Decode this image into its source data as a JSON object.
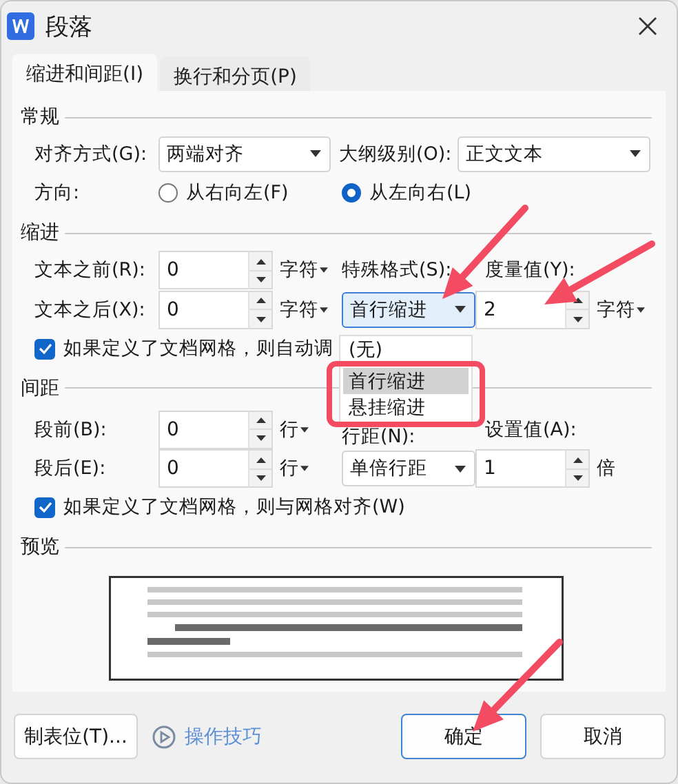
{
  "window": {
    "title": "段落"
  },
  "tabs": [
    {
      "label": "缩进和间距(I)",
      "selected": true
    },
    {
      "label": "换行和分页(P)",
      "selected": false
    }
  ],
  "general": {
    "title": "常规",
    "alignment": {
      "label": "对齐方式(G):",
      "value": "两端对齐"
    },
    "outline_level": {
      "label": "大纲级别(O):",
      "value": "正文文本"
    },
    "direction": {
      "label": "方向:",
      "options": [
        {
          "label": "从右向左(F)",
          "selected": false
        },
        {
          "label": "从左向右(L)",
          "selected": true
        }
      ]
    }
  },
  "indent": {
    "title": "缩进",
    "before": {
      "label": "文本之前(R):",
      "value": "0",
      "unit": "字符"
    },
    "after": {
      "label": "文本之后(X):",
      "value": "0",
      "unit": "字符"
    },
    "special": {
      "label": "特殊格式(S):",
      "value": "首行缩进"
    },
    "measure": {
      "label": "度量值(Y):",
      "value": "2",
      "unit": "字符"
    },
    "grid_check": {
      "label": "如果定义了文档网格，则自动调",
      "checked": true
    }
  },
  "special_menu": [
    {
      "label": "(无)",
      "selected": false
    },
    {
      "label": "首行缩进",
      "selected": true
    },
    {
      "label": "悬挂缩进",
      "selected": false
    }
  ],
  "spacing": {
    "title": "间距",
    "before": {
      "label": "段前(B):",
      "value": "0",
      "unit": "行"
    },
    "after": {
      "label": "段后(E):",
      "value": "0",
      "unit": "行"
    },
    "line": {
      "label": "行距(N):",
      "value": "单倍行距"
    },
    "set_value": {
      "label": "设置值(A):",
      "value": "1",
      "unit": "倍"
    },
    "grid_check": {
      "label": "如果定义了文档网格，则与网格对齐(W)",
      "checked": true
    }
  },
  "preview": {
    "title": "预览"
  },
  "footer": {
    "tabs_button": "制表位(T)...",
    "tips_link": "操作技巧",
    "buttons": [
      {
        "label": "确定",
        "kind": "primary"
      },
      {
        "label": "取消",
        "kind": "plain"
      }
    ]
  }
}
